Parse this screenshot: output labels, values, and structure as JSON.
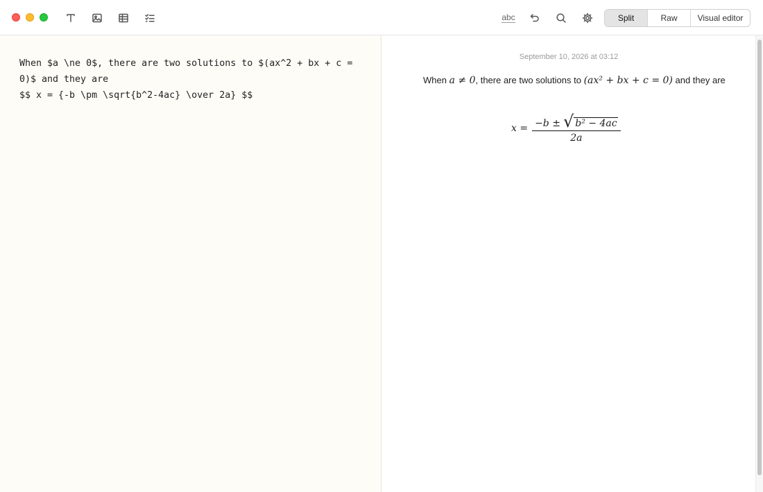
{
  "toolbar": {
    "icons": [
      "text-format-icon",
      "image-icon",
      "table-icon",
      "checklist-icon"
    ],
    "spellcheck_label": "abc",
    "right_icons": [
      "undo-icon",
      "search-icon",
      "gear-icon"
    ],
    "view_modes": [
      "Split",
      "Raw",
      "Visual editor"
    ],
    "active_view_mode": "Split"
  },
  "editor": {
    "raw_text": "When $a \\ne 0$, there are two solutions to $(ax^2 + bx + c = 0)$ and they are\n$$ x = {-b \\pm \\sqrt{b^2-4ac} \\over 2a} $$"
  },
  "preview": {
    "date": "September 10, 2026 at 03:12",
    "para_when": "When",
    "inline_math_1": "a ≠ 0",
    "para_mid": ", there are two solutions to",
    "inline_math_2": "(ax² + bx + c = 0)",
    "para_end": "and they are",
    "formula_lhs": "x =",
    "formula_num_pre": "−b ±",
    "formula_radicand": "b² − 4ac",
    "formula_den": "2a"
  },
  "colors": {
    "editor_bg": "#fefcf6",
    "close": "#ff5f57",
    "minimize": "#febc2e",
    "zoom": "#28c840"
  }
}
